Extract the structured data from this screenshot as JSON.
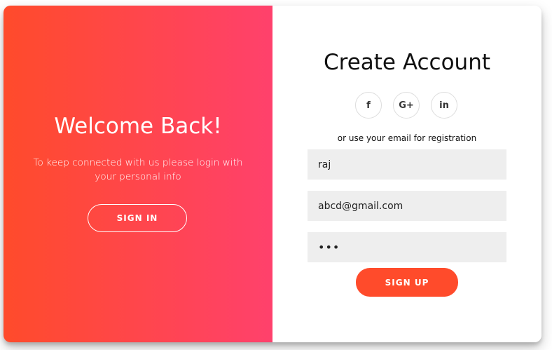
{
  "overlay": {
    "title": "Welcome Back!",
    "text": "To keep connected with us please login with your personal info",
    "sign_in_label": "SIGN IN",
    "gradient_start": "#ff4b2b",
    "gradient_end": "#ff416c"
  },
  "form": {
    "title": "Create Account",
    "socials": [
      {
        "icon": "facebook-icon",
        "glyph": "f"
      },
      {
        "icon": "google-plus-icon",
        "glyph": "G+"
      },
      {
        "icon": "linkedin-icon",
        "glyph": "in"
      }
    ],
    "subtitle": "or use your email for registration",
    "name_value": "raj",
    "email_value": "abcd@gmail.com",
    "password_value": "•••",
    "sign_up_label": "SIGN UP",
    "accent_color": "#ff4b2b"
  }
}
